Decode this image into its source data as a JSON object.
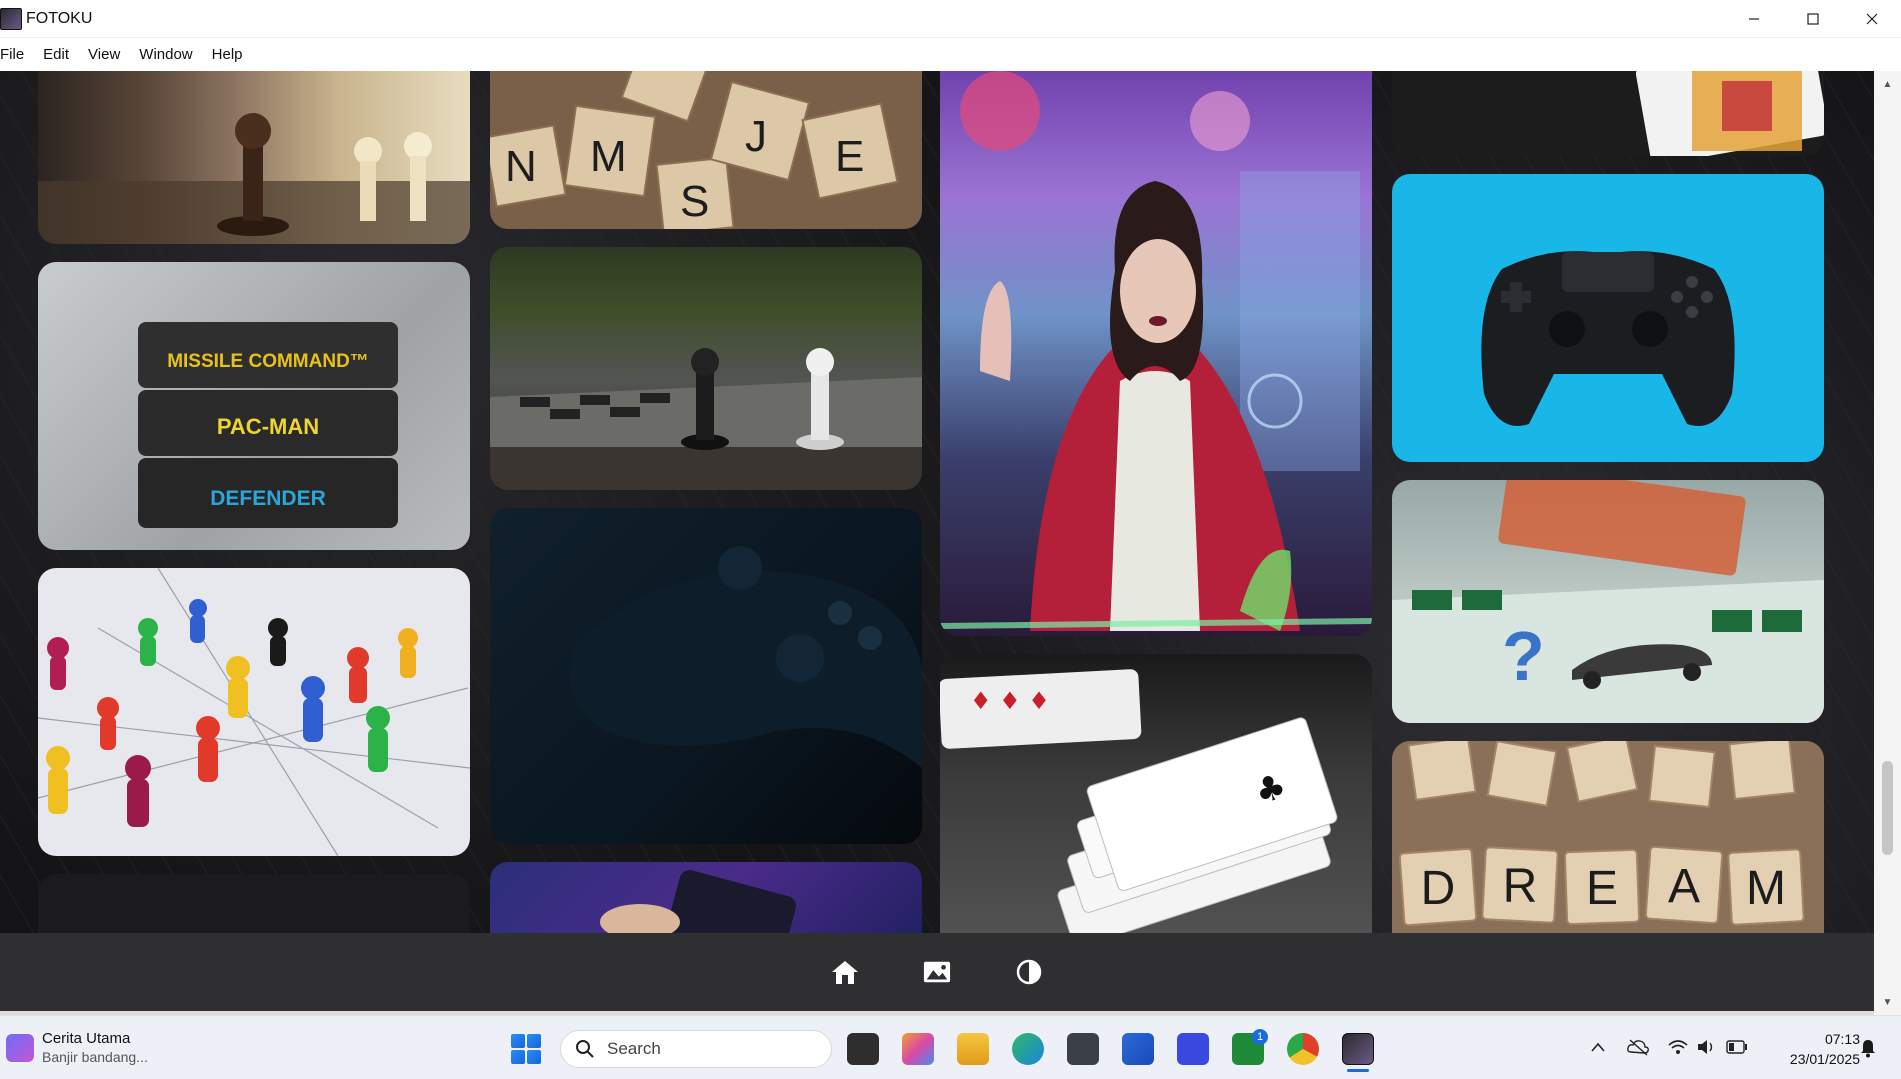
{
  "window": {
    "title": "FOTOKU",
    "minimize_glyph": "—",
    "maximize_glyph": "☐",
    "close_glyph": "✕"
  },
  "menu": {
    "items": [
      "File",
      "Edit",
      "View",
      "Window",
      "Help"
    ]
  },
  "gallery": {
    "tiles": [
      {
        "name": "chess-pieces-photo",
        "description_icon": "image"
      },
      {
        "name": "scrabble-letters-photo",
        "description_icon": "image"
      },
      {
        "name": "arcade-girl-photo",
        "description_icon": "image"
      },
      {
        "name": "playing-cards-king-photo",
        "description_icon": "image"
      },
      {
        "name": "atari-cartridges-photo",
        "description_icon": "image"
      },
      {
        "name": "chess-pawns-outdoor-photo",
        "description_icon": "image"
      },
      {
        "name": "ps4-controller-photo",
        "description_icon": "image"
      },
      {
        "name": "game-pawns-network-photo",
        "description_icon": "image"
      },
      {
        "name": "dark-controller-photo",
        "description_icon": "image"
      },
      {
        "name": "monopoly-photo",
        "description_icon": "image"
      },
      {
        "name": "poker-cards-photo",
        "description_icon": "image"
      },
      {
        "name": "dream-tiles-photo",
        "description_icon": "image"
      },
      {
        "name": "mobile-game-photo",
        "description_icon": "image"
      },
      {
        "name": "dark-tile-photo",
        "description_icon": "image"
      }
    ],
    "cartridge_labels": [
      "MISSILE COMMAND™",
      "PAC-MAN",
      "DEFENDER"
    ],
    "dream_letters": [
      "D",
      "R",
      "E",
      "A",
      "M"
    ]
  },
  "toolbar": {
    "icons": [
      "home-icon",
      "gallery-icon",
      "contrast-icon"
    ]
  },
  "taskbar": {
    "news_title": "Cerita Utama",
    "news_subtitle": "Banjir bandang...",
    "search_placeholder": "Search",
    "badge_count": "1",
    "time": "07:13",
    "date": "23/01/2025"
  },
  "colors": {
    "toolbar_bg": "#2f2f31",
    "content_bg": "#111113",
    "taskbar_bg": "#eef0f7"
  }
}
